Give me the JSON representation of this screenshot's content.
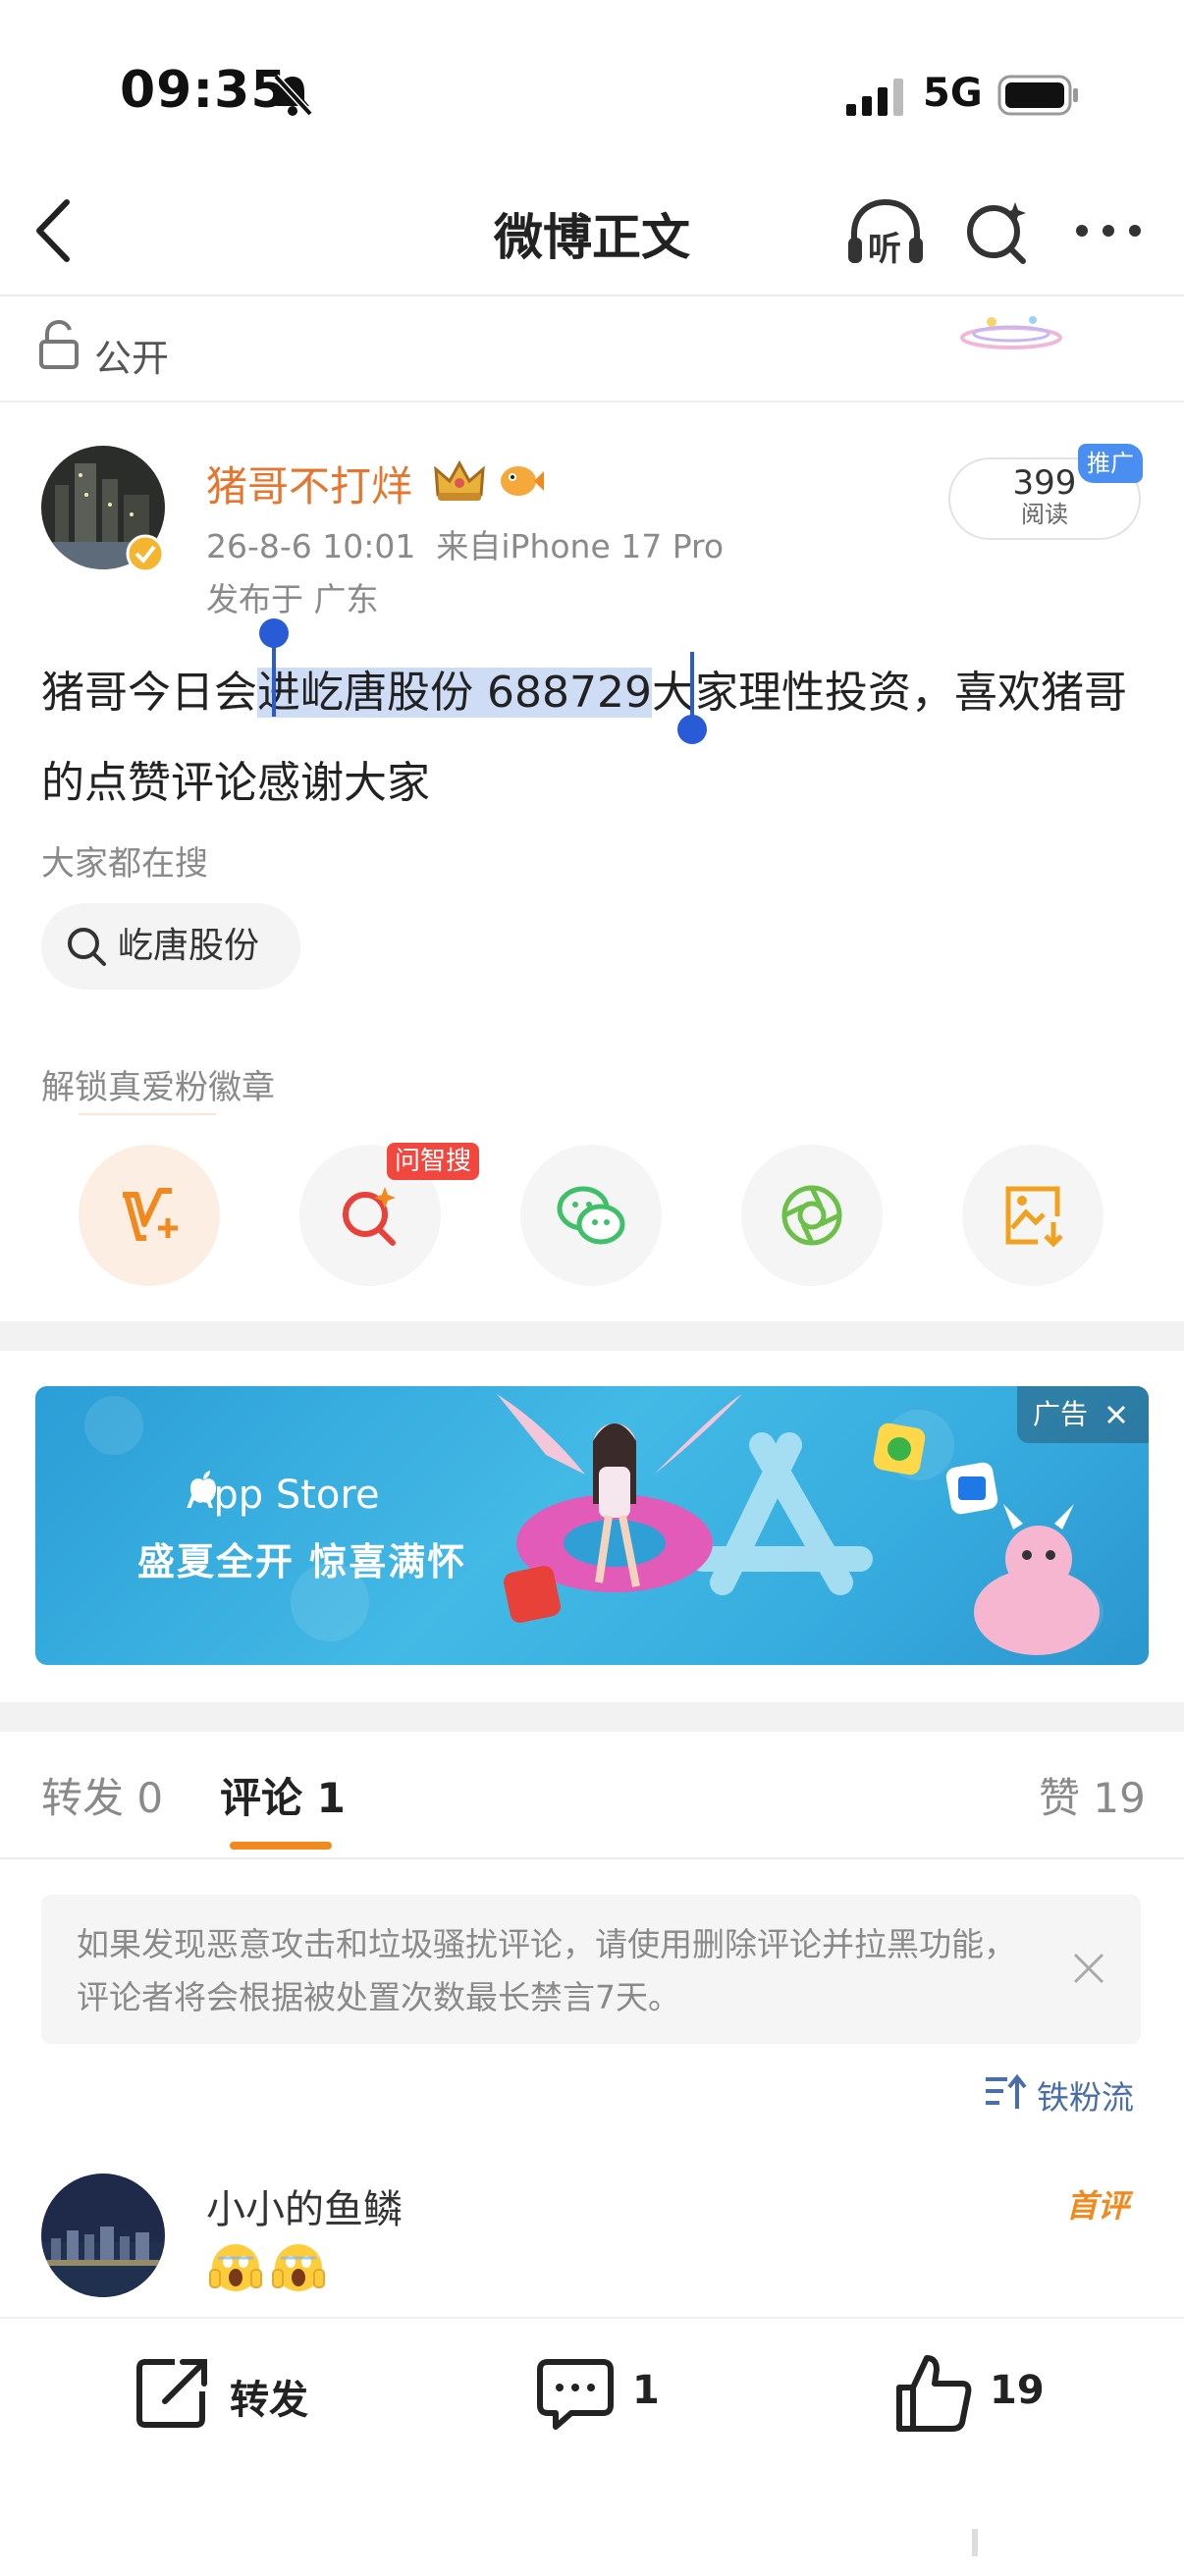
{
  "status_bar": {
    "time": "09:35",
    "network": "5G"
  },
  "nav": {
    "title": "微博正文",
    "listen_label": "听"
  },
  "visibility": {
    "label": "公开"
  },
  "post": {
    "author": "猪哥不打烊",
    "date": "26-8-6 10:01",
    "source": "来自iPhone 17 Pro",
    "location": "发布于 广东",
    "read_count": "399",
    "read_label": "阅读",
    "promo_label": "推广",
    "text_before": "猪哥今日会",
    "text_selected": "进屹唐股份 688729",
    "text_after": "大家理性投资，喜欢猪哥的点赞评论感谢大家"
  },
  "trending": {
    "label": "大家都在搜",
    "chip": "屹唐股份"
  },
  "badges": {
    "label": "解锁真爱粉徽章",
    "ask_badge": "问智搜"
  },
  "ad": {
    "tag": "广告",
    "brand": "App Store",
    "slogan": "盛夏全开 惊喜满怀"
  },
  "tabs": {
    "repost_label": "转发",
    "repost_count": "0",
    "comment_label": "评论",
    "comment_count": "1",
    "like_label": "赞",
    "like_count": "19"
  },
  "notice": {
    "text": "如果发现恶意攻击和垃圾骚扰评论，请使用删除评论并拉黑功能，评论者将会根据被处置次数最长禁言7天。"
  },
  "sort": {
    "label": "铁粉流"
  },
  "comment": {
    "author": "小小的鱼鳞",
    "badge": "首评",
    "content": "😱😱"
  },
  "bottom_bar": {
    "repost": "转发",
    "comment_count": "1",
    "like_count": "19"
  },
  "colors": {
    "accent": "#f08a1e",
    "author": "#e8752d",
    "selection": "#cfdcf6",
    "link_blue": "#4a6fa8"
  }
}
